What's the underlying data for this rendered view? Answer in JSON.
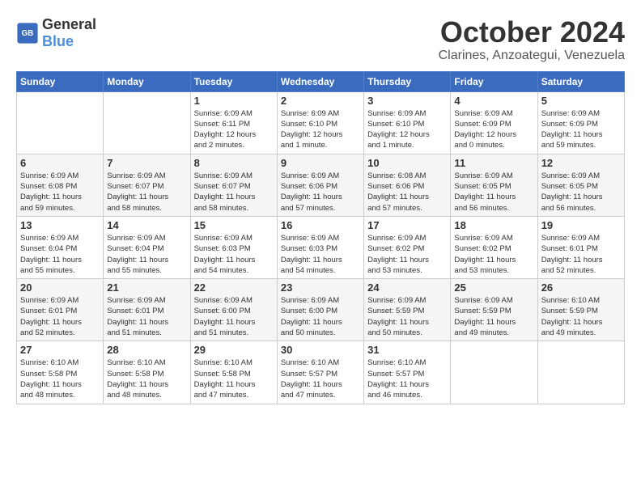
{
  "header": {
    "logo": {
      "general": "General",
      "blue": "Blue"
    },
    "month": "October 2024",
    "location": "Clarines, Anzoategui, Venezuela"
  },
  "weekdays": [
    "Sunday",
    "Monday",
    "Tuesday",
    "Wednesday",
    "Thursday",
    "Friday",
    "Saturday"
  ],
  "weeks": [
    [
      {
        "day": "",
        "info": ""
      },
      {
        "day": "",
        "info": ""
      },
      {
        "day": "1",
        "info": "Sunrise: 6:09 AM\nSunset: 6:11 PM\nDaylight: 12 hours\nand 2 minutes."
      },
      {
        "day": "2",
        "info": "Sunrise: 6:09 AM\nSunset: 6:10 PM\nDaylight: 12 hours\nand 1 minute."
      },
      {
        "day": "3",
        "info": "Sunrise: 6:09 AM\nSunset: 6:10 PM\nDaylight: 12 hours\nand 1 minute."
      },
      {
        "day": "4",
        "info": "Sunrise: 6:09 AM\nSunset: 6:09 PM\nDaylight: 12 hours\nand 0 minutes."
      },
      {
        "day": "5",
        "info": "Sunrise: 6:09 AM\nSunset: 6:09 PM\nDaylight: 11 hours\nand 59 minutes."
      }
    ],
    [
      {
        "day": "6",
        "info": "Sunrise: 6:09 AM\nSunset: 6:08 PM\nDaylight: 11 hours\nand 59 minutes."
      },
      {
        "day": "7",
        "info": "Sunrise: 6:09 AM\nSunset: 6:07 PM\nDaylight: 11 hours\nand 58 minutes."
      },
      {
        "day": "8",
        "info": "Sunrise: 6:09 AM\nSunset: 6:07 PM\nDaylight: 11 hours\nand 58 minutes."
      },
      {
        "day": "9",
        "info": "Sunrise: 6:09 AM\nSunset: 6:06 PM\nDaylight: 11 hours\nand 57 minutes."
      },
      {
        "day": "10",
        "info": "Sunrise: 6:08 AM\nSunset: 6:06 PM\nDaylight: 11 hours\nand 57 minutes."
      },
      {
        "day": "11",
        "info": "Sunrise: 6:09 AM\nSunset: 6:05 PM\nDaylight: 11 hours\nand 56 minutes."
      },
      {
        "day": "12",
        "info": "Sunrise: 6:09 AM\nSunset: 6:05 PM\nDaylight: 11 hours\nand 56 minutes."
      }
    ],
    [
      {
        "day": "13",
        "info": "Sunrise: 6:09 AM\nSunset: 6:04 PM\nDaylight: 11 hours\nand 55 minutes."
      },
      {
        "day": "14",
        "info": "Sunrise: 6:09 AM\nSunset: 6:04 PM\nDaylight: 11 hours\nand 55 minutes."
      },
      {
        "day": "15",
        "info": "Sunrise: 6:09 AM\nSunset: 6:03 PM\nDaylight: 11 hours\nand 54 minutes."
      },
      {
        "day": "16",
        "info": "Sunrise: 6:09 AM\nSunset: 6:03 PM\nDaylight: 11 hours\nand 54 minutes."
      },
      {
        "day": "17",
        "info": "Sunrise: 6:09 AM\nSunset: 6:02 PM\nDaylight: 11 hours\nand 53 minutes."
      },
      {
        "day": "18",
        "info": "Sunrise: 6:09 AM\nSunset: 6:02 PM\nDaylight: 11 hours\nand 53 minutes."
      },
      {
        "day": "19",
        "info": "Sunrise: 6:09 AM\nSunset: 6:01 PM\nDaylight: 11 hours\nand 52 minutes."
      }
    ],
    [
      {
        "day": "20",
        "info": "Sunrise: 6:09 AM\nSunset: 6:01 PM\nDaylight: 11 hours\nand 52 minutes."
      },
      {
        "day": "21",
        "info": "Sunrise: 6:09 AM\nSunset: 6:01 PM\nDaylight: 11 hours\nand 51 minutes."
      },
      {
        "day": "22",
        "info": "Sunrise: 6:09 AM\nSunset: 6:00 PM\nDaylight: 11 hours\nand 51 minutes."
      },
      {
        "day": "23",
        "info": "Sunrise: 6:09 AM\nSunset: 6:00 PM\nDaylight: 11 hours\nand 50 minutes."
      },
      {
        "day": "24",
        "info": "Sunrise: 6:09 AM\nSunset: 5:59 PM\nDaylight: 11 hours\nand 50 minutes."
      },
      {
        "day": "25",
        "info": "Sunrise: 6:09 AM\nSunset: 5:59 PM\nDaylight: 11 hours\nand 49 minutes."
      },
      {
        "day": "26",
        "info": "Sunrise: 6:10 AM\nSunset: 5:59 PM\nDaylight: 11 hours\nand 49 minutes."
      }
    ],
    [
      {
        "day": "27",
        "info": "Sunrise: 6:10 AM\nSunset: 5:58 PM\nDaylight: 11 hours\nand 48 minutes."
      },
      {
        "day": "28",
        "info": "Sunrise: 6:10 AM\nSunset: 5:58 PM\nDaylight: 11 hours\nand 48 minutes."
      },
      {
        "day": "29",
        "info": "Sunrise: 6:10 AM\nSunset: 5:58 PM\nDaylight: 11 hours\nand 47 minutes."
      },
      {
        "day": "30",
        "info": "Sunrise: 6:10 AM\nSunset: 5:57 PM\nDaylight: 11 hours\nand 47 minutes."
      },
      {
        "day": "31",
        "info": "Sunrise: 6:10 AM\nSunset: 5:57 PM\nDaylight: 11 hours\nand 46 minutes."
      },
      {
        "day": "",
        "info": ""
      },
      {
        "day": "",
        "info": ""
      }
    ]
  ]
}
